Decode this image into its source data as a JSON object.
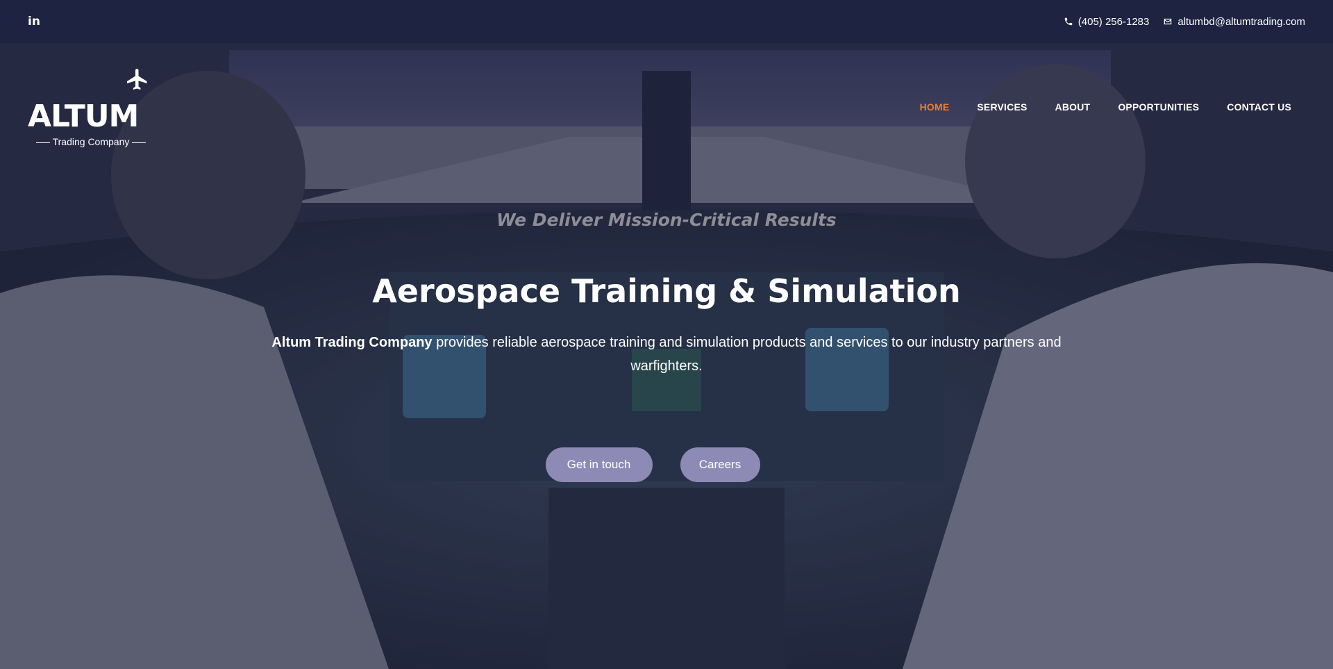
{
  "topbar": {
    "social": {
      "label": "in",
      "icon": "linkedin-icon"
    },
    "phone": {
      "icon": "phone-icon",
      "text": "(405) 256-1283"
    },
    "email": {
      "icon": "envelope-icon",
      "text": "altumbd@altumtrading.com"
    }
  },
  "logo": {
    "wordmark": "ALTUM",
    "subtitle": "Trading Company",
    "icon": "airplane-icon"
  },
  "nav": {
    "items": [
      {
        "label": "HOME",
        "active": true
      },
      {
        "label": "SERVICES",
        "active": false
      },
      {
        "label": "ABOUT",
        "active": false
      },
      {
        "label": "OPPORTUNITIES",
        "active": false
      },
      {
        "label": "CONTACT US",
        "active": false
      }
    ]
  },
  "hero": {
    "tagline": "We Deliver Mission-Critical Results",
    "headline": "Aerospace Training & Simulation",
    "description_bold": "Altum Trading Company",
    "description_rest": " provides reliable aerospace training and simulation products and services to our industry partners and warfighters.",
    "buttons": {
      "primary": "Get in touch",
      "secondary": "Careers"
    }
  },
  "colors": {
    "topbar": "#1d2340",
    "accent": "#f07d2e",
    "button": "#8d8bb5"
  }
}
